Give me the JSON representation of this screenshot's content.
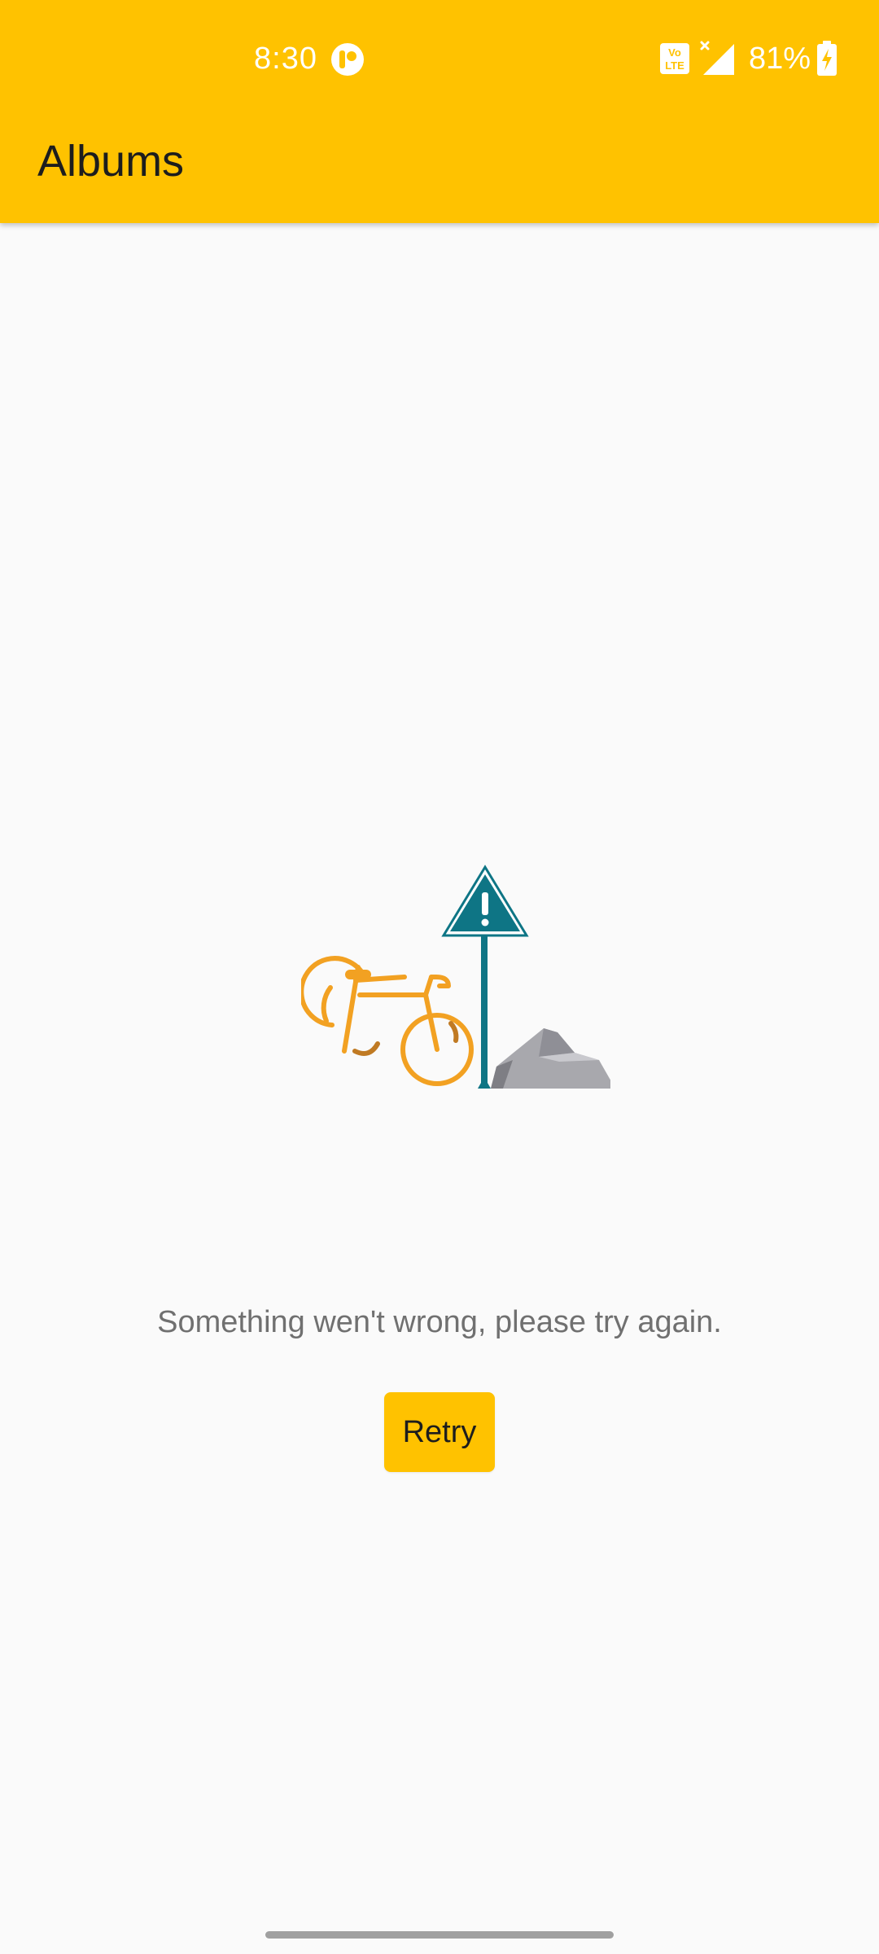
{
  "status_bar": {
    "time": "8:30",
    "battery_percent": "81%",
    "icons": [
      "notification-app-icon",
      "volte-icon",
      "signal-no-data-icon",
      "battery-charging-icon"
    ]
  },
  "app_bar": {
    "title": "Albums",
    "background_color": "#ffc200"
  },
  "content": {
    "illustration": "error-illustration",
    "error_message": "Something wen't wrong, please try again.",
    "retry_label": "Retry"
  },
  "colors": {
    "accent": "#ffc200",
    "bike": "#f2a122",
    "sign": "#0e7585",
    "rock": "#a8a8ad"
  }
}
